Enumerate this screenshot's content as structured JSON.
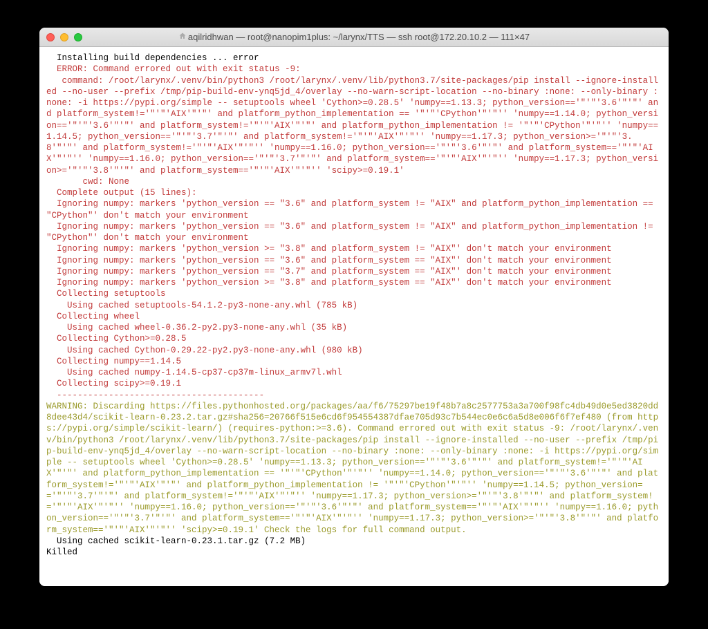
{
  "window": {
    "title_prefix": "aqilridhwan — root@nanopim1plus: ~/larynx/TTS — ssh root@172.20.10.2 — 111×47"
  },
  "terminal": {
    "lines": [
      {
        "class": "line-default",
        "text": "  Installing build dependencies ... error"
      },
      {
        "class": "line-error",
        "text": "  ERROR: Command errored out with exit status -9:"
      },
      {
        "class": "line-error",
        "text": "   command: /root/larynx/.venv/bin/python3 /root/larynx/.venv/lib/python3.7/site-packages/pip install --ignore-installed --no-user --prefix /tmp/pip-build-env-ynq5jd_4/overlay --no-warn-script-location --no-binary :none: --only-binary :none: -i https://pypi.org/simple -- setuptools wheel 'Cython>=0.28.5' 'numpy==1.13.3; python_version=='\"'\"'3.6'\"'\"' and platform_system!='\"'\"'AIX'\"'\"' and platform_python_implementation == '\"'\"'CPython'\"'\"'' 'numpy==1.14.0; python_version=='\"'\"'3.6'\"'\"' and platform_system!='\"'\"'AIX'\"'\"' and platform_python_implementation != '\"'\"'CPython'\"'\"'' 'numpy==1.14.5; python_version=='\"'\"'3.7'\"'\"' and platform_system!='\"'\"'AIX'\"'\"'' 'numpy==1.17.3; python_version>='\"'\"'3.8'\"'\"' and platform_system!='\"'\"'AIX'\"'\"'' 'numpy==1.16.0; python_version=='\"'\"'3.6'\"'\"' and platform_system=='\"'\"'AIX'\"'\"'' 'numpy==1.16.0; python_version=='\"'\"'3.7'\"'\"' and platform_system=='\"'\"'AIX'\"'\"'' 'numpy==1.17.3; python_version>='\"'\"'3.8'\"'\"' and platform_system=='\"'\"'AIX'\"'\"'' 'scipy>=0.19.1'"
      },
      {
        "class": "line-error",
        "text": "       cwd: None"
      },
      {
        "class": "line-error",
        "text": "  Complete output (15 lines):"
      },
      {
        "class": "line-error",
        "text": "  Ignoring numpy: markers 'python_version == \"3.6\" and platform_system != \"AIX\" and platform_python_implementation == \"CPython\"' don't match your environment"
      },
      {
        "class": "line-error",
        "text": "  Ignoring numpy: markers 'python_version == \"3.6\" and platform_system != \"AIX\" and platform_python_implementation != \"CPython\"' don't match your environment"
      },
      {
        "class": "line-error",
        "text": "  Ignoring numpy: markers 'python_version >= \"3.8\" and platform_system != \"AIX\"' don't match your environment"
      },
      {
        "class": "line-error",
        "text": "  Ignoring numpy: markers 'python_version == \"3.6\" and platform_system == \"AIX\"' don't match your environment"
      },
      {
        "class": "line-error",
        "text": "  Ignoring numpy: markers 'python_version == \"3.7\" and platform_system == \"AIX\"' don't match your environment"
      },
      {
        "class": "line-error",
        "text": "  Ignoring numpy: markers 'python_version >= \"3.8\" and platform_system == \"AIX\"' don't match your environment"
      },
      {
        "class": "line-error",
        "text": "  Collecting setuptools"
      },
      {
        "class": "line-error",
        "text": "    Using cached setuptools-54.1.2-py3-none-any.whl (785 kB)"
      },
      {
        "class": "line-error",
        "text": "  Collecting wheel"
      },
      {
        "class": "line-error",
        "text": "    Using cached wheel-0.36.2-py2.py3-none-any.whl (35 kB)"
      },
      {
        "class": "line-error",
        "text": "  Collecting Cython>=0.28.5"
      },
      {
        "class": "line-error",
        "text": "    Using cached Cython-0.29.22-py2.py3-none-any.whl (980 kB)"
      },
      {
        "class": "line-error",
        "text": "  Collecting numpy==1.14.5"
      },
      {
        "class": "line-error",
        "text": "    Using cached numpy-1.14.5-cp37-cp37m-linux_armv7l.whl"
      },
      {
        "class": "line-error",
        "text": "  Collecting scipy>=0.19.1"
      },
      {
        "class": "line-error",
        "text": "  ----------------------------------------"
      },
      {
        "class": "line-warning",
        "text": "WARNING: Discarding https://files.pythonhosted.org/packages/aa/f6/75297be19f48b7a8c2577753a3a700f98fc4db49d0e5ed3820dd8dee43d4/scikit-learn-0.23.2.tar.gz#sha256=20766f515e6cd6f954554387dfae705d93c7b544ec0e6c6a5d8e006f6f7ef480 (from https://pypi.org/simple/scikit-learn/) (requires-python:>=3.6). Command errored out with exit status -9: /root/larynx/.venv/bin/python3 /root/larynx/.venv/lib/python3.7/site-packages/pip install --ignore-installed --no-user --prefix /tmp/pip-build-env-ynq5jd_4/overlay --no-warn-script-location --no-binary :none: --only-binary :none: -i https://pypi.org/simple -- setuptools wheel 'Cython>=0.28.5' 'numpy==1.13.3; python_version=='\"'\"'3.6'\"'\"' and platform_system!='\"'\"'AIX'\"'\"' and platform_python_implementation == '\"'\"'CPython'\"'\"'' 'numpy==1.14.0; python_version=='\"'\"'3.6'\"'\"' and platform_system!='\"'\"'AIX'\"'\"' and platform_python_implementation != '\"'\"'CPython'\"'\"'' 'numpy==1.14.5; python_version=='\"'\"'3.7'\"'\"' and platform_system!='\"'\"'AIX'\"'\"'' 'numpy==1.17.3; python_version>='\"'\"'3.8'\"'\"' and platform_system!='\"'\"'AIX'\"'\"'' 'numpy==1.16.0; python_version=='\"'\"'3.6'\"'\"' and platform_system=='\"'\"'AIX'\"'\"'' 'numpy==1.16.0; python_version=='\"'\"'3.7'\"'\"' and platform_system=='\"'\"'AIX'\"'\"'' 'numpy==1.17.3; python_version>='\"'\"'3.8'\"'\"' and platform_system=='\"'\"'AIX'\"'\"'' 'scipy>=0.19.1' Check the logs for full command output."
      },
      {
        "class": "line-default",
        "text": "  Using cached scikit-learn-0.23.1.tar.gz (7.2 MB)"
      },
      {
        "class": "line-default",
        "text": "Killed"
      }
    ]
  }
}
